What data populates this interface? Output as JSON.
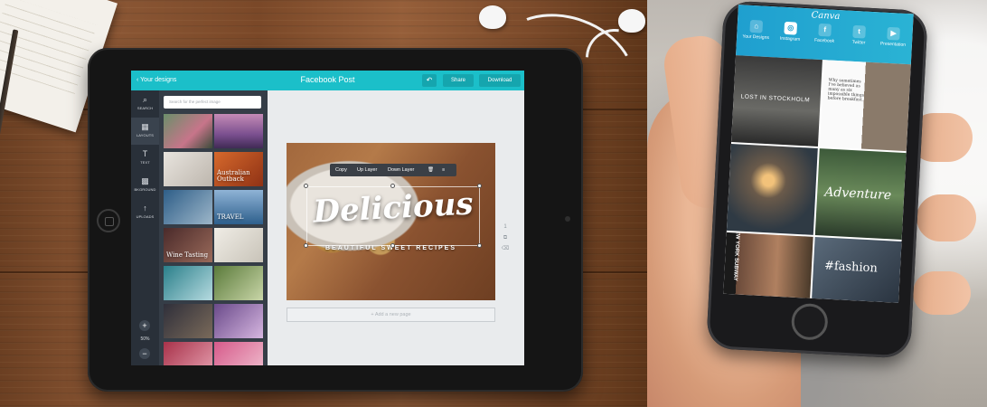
{
  "tablet_app": {
    "back_label": "‹ Your designs",
    "doc_title": "Facebook Post",
    "undo_icon": "↶",
    "share_label": "Share",
    "download_label": "Download",
    "sidebar": [
      {
        "icon": "⌕",
        "label": "SEARCH"
      },
      {
        "icon": "▦",
        "label": "LAYOUTS"
      },
      {
        "icon": "T",
        "label": "TEXT"
      },
      {
        "icon": "▩",
        "label": "BKGROUND"
      },
      {
        "icon": "↑",
        "label": "UPLOADS"
      }
    ],
    "zoom_plus": "+",
    "zoom_level": "50%",
    "zoom_minus": "−",
    "search_placeholder": "Search for the perfect image",
    "thumb_texts": [
      "Australian Outback",
      "TRAVEL",
      "Wine Tasting"
    ],
    "context_menu": {
      "copy": "Copy",
      "up": "Up Layer",
      "down": "Down Layer",
      "delete_icon": "🗑",
      "align_icon": "≡"
    },
    "design": {
      "title": "Delicious",
      "subtitle": "BEAUTIFUL SWEET RECIPES"
    },
    "page_number": "1",
    "add_page_label": "+ Add a new page"
  },
  "phone_app": {
    "logo": "Canva",
    "tabs": [
      {
        "icon": "⌂",
        "label": "Your Designs"
      },
      {
        "icon": "◎",
        "label": "Instagram"
      },
      {
        "icon": "f",
        "label": "Facebook"
      },
      {
        "icon": "t",
        "label": "Twitter"
      },
      {
        "icon": "▶",
        "label": "Presentation"
      }
    ],
    "tiles": {
      "stockholm": "LOST IN STOCKHOLM",
      "quote": "Why sometimes I've believed as many as six impossible things before breakfast.",
      "adventure": "Adventure",
      "nyc": "NEW YORK SUBWAY",
      "fashion": "#fashion"
    }
  },
  "colors": {
    "canva_teal": "#1bbfc9",
    "sidebar_dark": "#293039",
    "phone_blue": "#1f9fcf"
  }
}
